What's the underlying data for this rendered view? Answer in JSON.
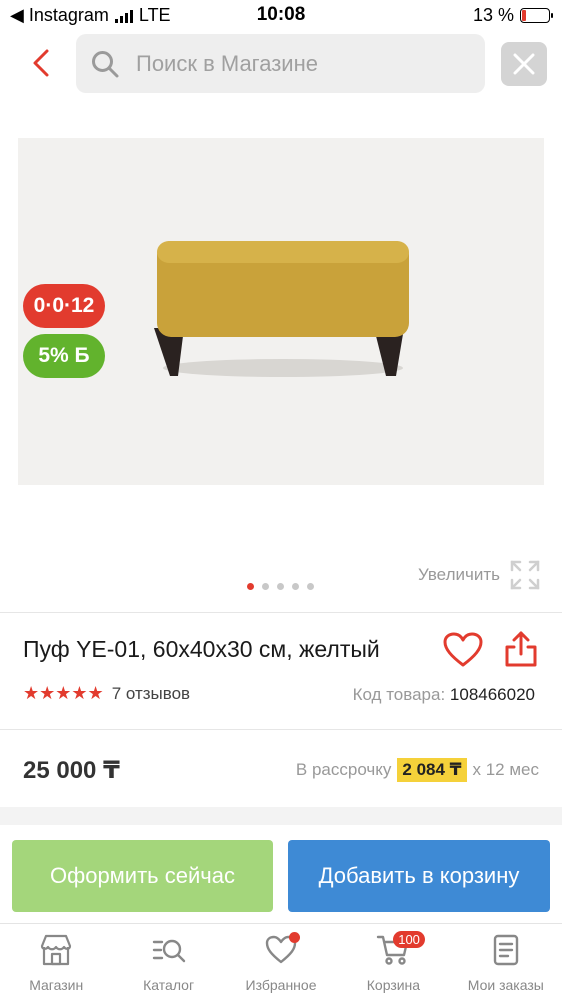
{
  "status_bar": {
    "back_app": "◀ Instagram",
    "network": "LTE",
    "time": "10:08",
    "battery": "13 %"
  },
  "search": {
    "placeholder": "Поиск в Магазине"
  },
  "badges": {
    "installment": "0·0·12",
    "bonus": "5% Б"
  },
  "gallery": {
    "zoom_label": "Увеличить",
    "image_count": 5,
    "active_index": 0
  },
  "product": {
    "title": "Пуф YE-01, 60x40x30 см, желтый",
    "rating": 5,
    "reviews": "7 отзывов",
    "code_label": "Код товара:",
    "code_value": "108466020",
    "price": "25 000 ₸",
    "installment_prefix": "В рассрочку",
    "installment_amount": "2 084 ₸",
    "installment_suffix": "x 12 мес"
  },
  "actions": {
    "buy_now": "Оформить сейчас",
    "add_to_cart": "Добавить в корзину"
  },
  "tabbar": {
    "items": [
      {
        "label": "Магазин",
        "icon": "store-icon"
      },
      {
        "label": "Каталог",
        "icon": "catalog-search-icon"
      },
      {
        "label": "Избранное",
        "icon": "heart-icon"
      },
      {
        "label": "Корзина",
        "icon": "cart-icon",
        "count": "100"
      },
      {
        "label": "Мои заказы",
        "icon": "orders-icon"
      }
    ]
  },
  "colors": {
    "accent_red": "#e23b2e",
    "bonus_green": "#62b32d",
    "buy_now_green": "#a4d67b",
    "cart_blue": "#3e8ad5",
    "highlight_yellow": "#f5d13a"
  }
}
